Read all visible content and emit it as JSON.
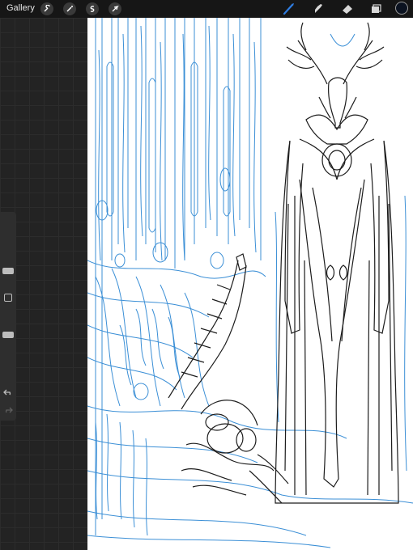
{
  "toolbar": {
    "gallery_label": "Gallery",
    "left_tools": [
      "actions-wrench",
      "adjustments-wand",
      "selection-s",
      "transform-arrow"
    ],
    "right_tools": [
      "brush",
      "smudge",
      "eraser",
      "layers"
    ],
    "active_tool": "brush",
    "accent_color": "#2f7de1",
    "current_color": "#0b1220"
  },
  "sidebar": {
    "brush_size_level": 0.25,
    "opacity_level": 0.6,
    "undo_icon": "undo-icon",
    "redo_icon": "redo-icon"
  },
  "canvas": {
    "sketch_color": "#3b8fd6",
    "ink_color": "#1c1c1c"
  }
}
